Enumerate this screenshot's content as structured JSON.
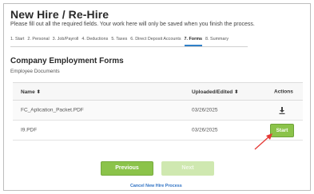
{
  "header": {
    "title": "New Hire / Re-Hire",
    "subtitle": "Please fill out all the required fields. Your work here will only be saved when you finish the process."
  },
  "steps": [
    {
      "label": "1. Start",
      "active": false
    },
    {
      "label": "2. Personal",
      "active": false
    },
    {
      "label": "3. Job/Payroll",
      "active": false
    },
    {
      "label": "4. Deductions",
      "active": false
    },
    {
      "label": "5. Taxes",
      "active": false
    },
    {
      "label": "6. Direct Deposit Accounts",
      "active": false
    },
    {
      "label": "7. Forms",
      "active": true
    },
    {
      "label": "8. Summary",
      "active": false
    }
  ],
  "section": {
    "title": "Company Employment Forms",
    "subtitle": "Employee Documents"
  },
  "table": {
    "headers": {
      "name": "Name ⬍",
      "date": "Uploaded/Edited ⬍",
      "actions": "Actions"
    },
    "rows": [
      {
        "name": "FC_Aplication_Packet.PDF",
        "date": "03/26/2025",
        "action": "download-icon"
      },
      {
        "name": "I9.PDF",
        "date": "03/26/2025",
        "action_label": "Start"
      }
    ]
  },
  "footer": {
    "previous_label": "Previous",
    "next_label": "Next",
    "cancel_label": "Cancel New Hire Process"
  },
  "colors": {
    "primary_green": "#8bc34a",
    "disabled_green": "#cfe8b0",
    "active_tab": "#2f80c8",
    "link": "#2f72c4",
    "annotation_arrow": "#e53935"
  }
}
